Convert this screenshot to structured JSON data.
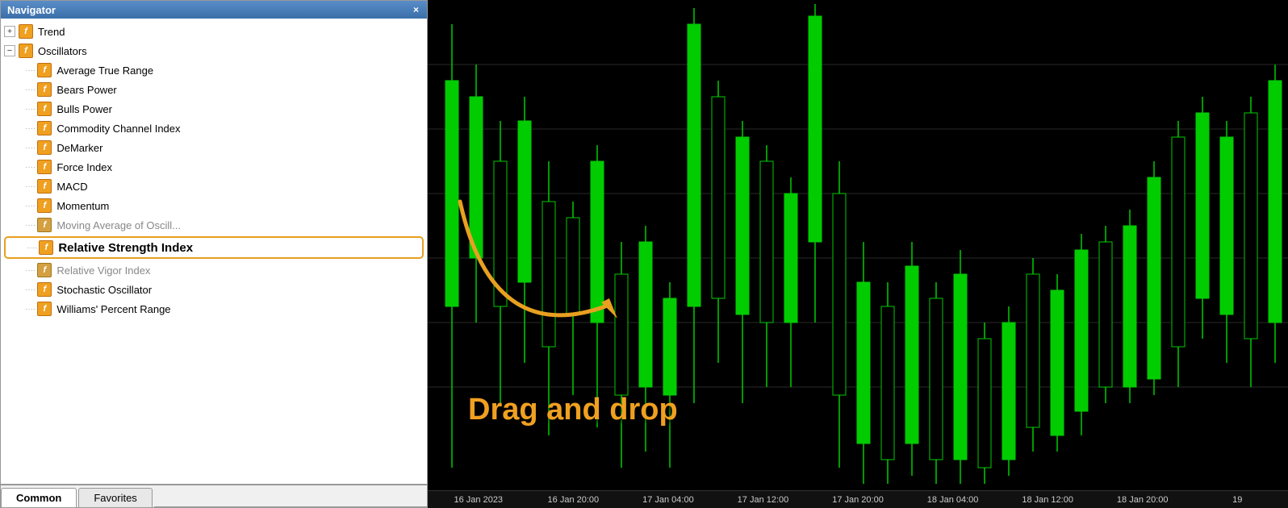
{
  "navigator": {
    "title": "Navigator",
    "close_label": "×",
    "tree": {
      "trend_label": "Trend",
      "oscillators_label": "Oscillators",
      "items": [
        {
          "label": "Average True Range",
          "dimmed": false
        },
        {
          "label": "Bears Power",
          "dimmed": false
        },
        {
          "label": "Bulls Power",
          "dimmed": false
        },
        {
          "label": "Commodity Channel Index",
          "dimmed": false
        },
        {
          "label": "DeMarker",
          "dimmed": false
        },
        {
          "label": "Force Index",
          "dimmed": false
        },
        {
          "label": "MACD",
          "dimmed": false
        },
        {
          "label": "Momentum",
          "dimmed": false
        },
        {
          "label": "Moving Average of Oscillator",
          "dimmed": true
        },
        {
          "label": "Relative Strength Index",
          "selected": true,
          "dimmed": false
        },
        {
          "label": "Relative Vigor Index",
          "dimmed": true
        },
        {
          "label": "Stochastic Oscillator",
          "dimmed": false
        },
        {
          "label": "Williams' Percent Range",
          "dimmed": false
        }
      ]
    },
    "tabs": [
      {
        "label": "Common",
        "active": true
      },
      {
        "label": "Favorites",
        "active": false
      }
    ]
  },
  "chart": {
    "drag_drop_text": "Drag and drop",
    "time_labels": [
      "16 Jan 2023",
      "16 Jan 20:00",
      "17 Jan 04:00",
      "17 Jan 12:00",
      "17 Jan 20:00",
      "18 Jan 04:00",
      "18 Jan 12:00",
      "18 Jan 20:00",
      "19"
    ]
  },
  "icons": {
    "func_char": "f",
    "expand_plus": "+",
    "expand_minus": "−",
    "close_char": "✕"
  }
}
